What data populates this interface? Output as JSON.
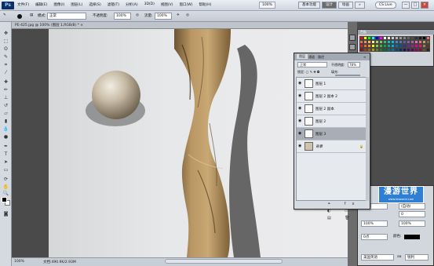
{
  "app": {
    "logo": "Ps"
  },
  "menu": [
    "文件(F)",
    "编辑(E)",
    "图像(I)",
    "图层(L)",
    "选择(S)",
    "滤镜(T)",
    "分析(A)",
    "3D(D)",
    "视图(V)",
    "窗口(W)",
    "帮助(H)"
  ],
  "zoom": "100%",
  "workspaces": [
    {
      "label": "基本功能",
      "active": false
    },
    {
      "label": "设计",
      "active": true
    },
    {
      "label": "绘画",
      "active": false
    },
    {
      "label": "»",
      "active": false
    }
  ],
  "cs_live": "CS Live",
  "window_controls": [
    "—",
    "□",
    "×"
  ],
  "options_bar": {
    "mode_label": "模式:",
    "mode_value": "正常",
    "opacity_label": "不透明度:",
    "opacity_value": "100%",
    "flow_label": "流量:",
    "flow_value": "100%"
  },
  "document": {
    "tab_title": "PE-425.jpg @ 100% (图层 1,RGB/8) * ×",
    "status_zoom": "100%",
    "status_doc": "文档:490.9K/2.93M"
  },
  "layers_panel": {
    "tabs": [
      "图层",
      "通道",
      "路径"
    ],
    "blend_mode": "正常",
    "opacity_label": "不透明度:",
    "opacity": "78%",
    "lock_label": "锁定:",
    "fill_label": "填充:",
    "layers": [
      {
        "name": "图层 1",
        "visible": true,
        "selected": false,
        "locked": false
      },
      {
        "name": "图层 2 副本 2",
        "visible": true,
        "selected": false,
        "locked": false
      },
      {
        "name": "图层 2 副本",
        "visible": true,
        "selected": false,
        "locked": false
      },
      {
        "name": "图层 2",
        "visible": true,
        "selected": false,
        "locked": false
      },
      {
        "name": "图层 3",
        "visible": true,
        "selected": true,
        "locked": false
      },
      {
        "name": "背景",
        "visible": true,
        "selected": false,
        "locked": true
      }
    ],
    "footer_icons": "⚭ fx ◐ ▭ ▤ 🗑"
  },
  "swatches_panel": {
    "title": "色板",
    "colors": [
      "#ff0000",
      "#ffff00",
      "#00ff00",
      "#00ffff",
      "#0000ff",
      "#ff00ff",
      "#ffffff",
      "#e6e6e6",
      "#cccccc",
      "#b3b3b3",
      "#999999",
      "#808080",
      "#666666",
      "#4d4d4d",
      "#333333",
      "#1a1a1a",
      "#000000",
      "#ff6666",
      "#f26c4f",
      "#f68e55",
      "#fbaf5d",
      "#fff467",
      "#acd372",
      "#7cc576",
      "#3bb878",
      "#1abbb4",
      "#00bff3",
      "#438ccb",
      "#5574b9",
      "#605ca8",
      "#855fa8",
      "#a763a8",
      "#f06ea9",
      "#f26d7d",
      "#c69c6e",
      "#8c6239",
      "#ed1c24",
      "#f26522",
      "#f7941d",
      "#fff200",
      "#8dc63f",
      "#39b54a",
      "#00a651",
      "#00a99d",
      "#00aeef",
      "#0072bc",
      "#0054a6",
      "#2e3192",
      "#662d91",
      "#92278f",
      "#ec008c",
      "#ed145b",
      "#a67c52",
      "#603913",
      "#9e0b0f",
      "#a0410d",
      "#a36209",
      "#aba000",
      "#598527",
      "#1a7b30",
      "#007236",
      "#00746b",
      "#0076a3",
      "#004b80",
      "#003471",
      "#1b1464",
      "#440e62",
      "#630460",
      "#9e005d",
      "#9e0039",
      "#754c24",
      "#3c2415"
    ]
  },
  "character_panel": {
    "font_size": "17点",
    "leading": "(自动)",
    "tracking": "0",
    "scale_v": "100%",
    "scale_h": "100%",
    "baseline": "0点",
    "color_label": "颜色:",
    "language": "美国英语",
    "aa_label": "aa",
    "aa_value": "锐利"
  },
  "watermark": {
    "title": "漫游世界",
    "url": "www.lesworld.com"
  }
}
